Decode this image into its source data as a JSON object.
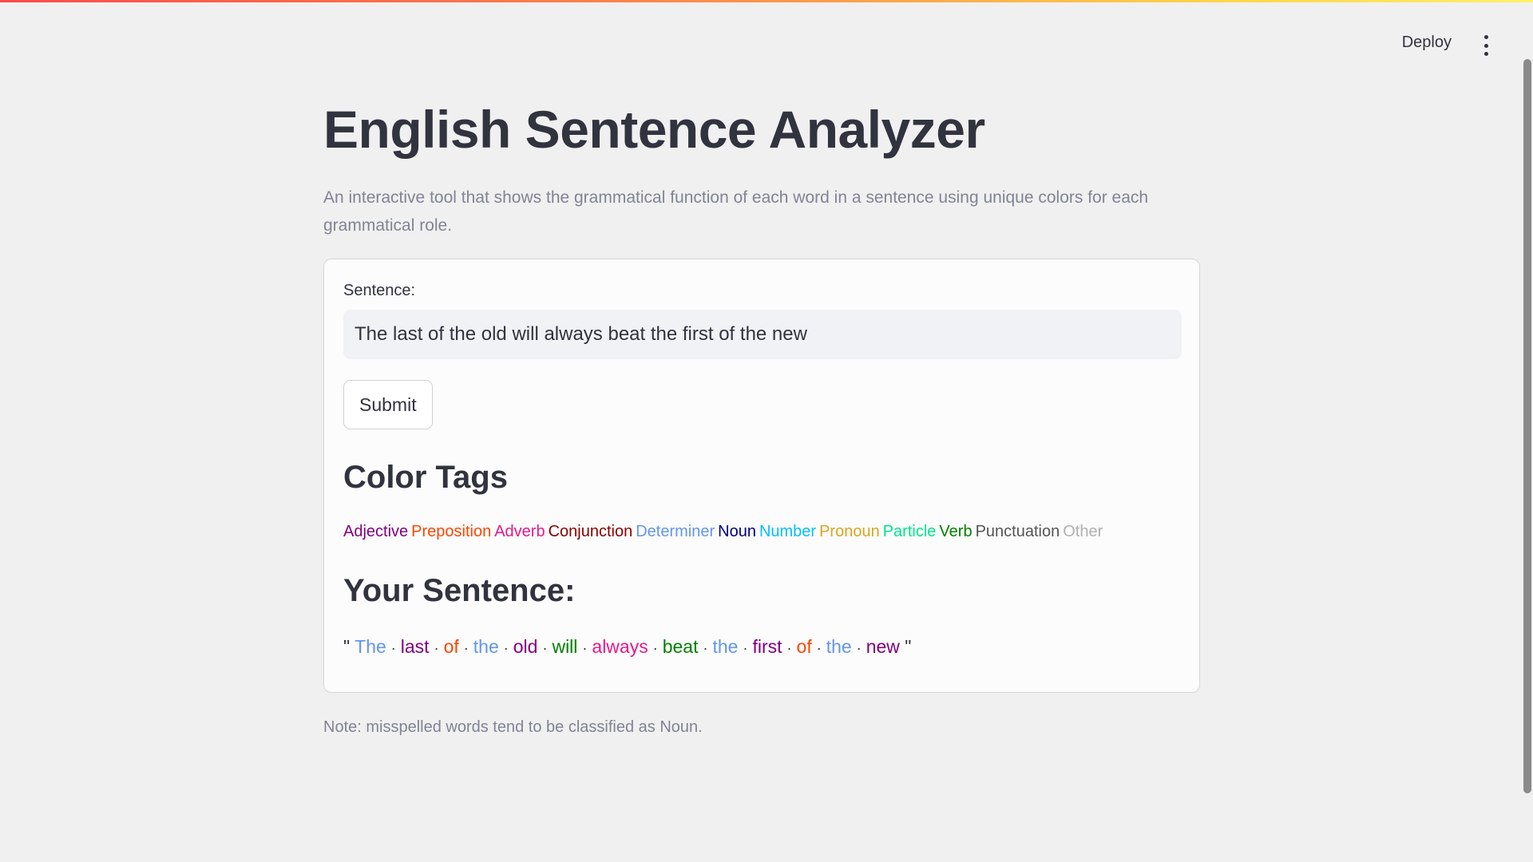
{
  "header": {
    "deploy_label": "Deploy",
    "menu_icon": "kebab-menu-icon"
  },
  "main": {
    "title": "English Sentence Analyzer",
    "description": "An interactive tool that shows the grammatical function of each word in a sentence using unique colors for each grammatical role.",
    "form": {
      "label": "Sentence:",
      "input_value": "The last of the old will always beat the first of the new",
      "submit_label": "Submit"
    },
    "color_tags_heading": "Color Tags",
    "tags": [
      {
        "label": "Adjective",
        "color": "#800080"
      },
      {
        "label": "Preposition",
        "color": "#ff4500"
      },
      {
        "label": "Adverb",
        "color": "#e6198c"
      },
      {
        "label": "Conjunction",
        "color": "#8b0000"
      },
      {
        "label": "Determiner",
        "color": "#6495ed"
      },
      {
        "label": "Noun",
        "color": "#000080"
      },
      {
        "label": "Number",
        "color": "#00bfff"
      },
      {
        "label": "Pronoun",
        "color": "#daa520"
      },
      {
        "label": "Particle",
        "color": "#00e68a"
      },
      {
        "label": "Verb",
        "color": "#008000"
      },
      {
        "label": "Punctuation",
        "color": "#555555"
      },
      {
        "label": "Other",
        "color": "#b0b0b0"
      }
    ],
    "sentence_heading": "Your Sentence:",
    "quote_open": "\"",
    "quote_close": "\"",
    "separator": "·",
    "words": [
      {
        "text": "The",
        "color": "#6495ed"
      },
      {
        "text": "last",
        "color": "#800080"
      },
      {
        "text": "of",
        "color": "#ff4500"
      },
      {
        "text": "the",
        "color": "#6495ed"
      },
      {
        "text": "old",
        "color": "#800080"
      },
      {
        "text": "will",
        "color": "#008000"
      },
      {
        "text": "always",
        "color": "#e6198c"
      },
      {
        "text": "beat",
        "color": "#008000"
      },
      {
        "text": "the",
        "color": "#6495ed"
      },
      {
        "text": "first",
        "color": "#800080"
      },
      {
        "text": "of",
        "color": "#ff4500"
      },
      {
        "text": "the",
        "color": "#6495ed"
      },
      {
        "text": "new",
        "color": "#800080"
      }
    ],
    "note": "Note: misspelled words tend to be classified as Noun."
  }
}
